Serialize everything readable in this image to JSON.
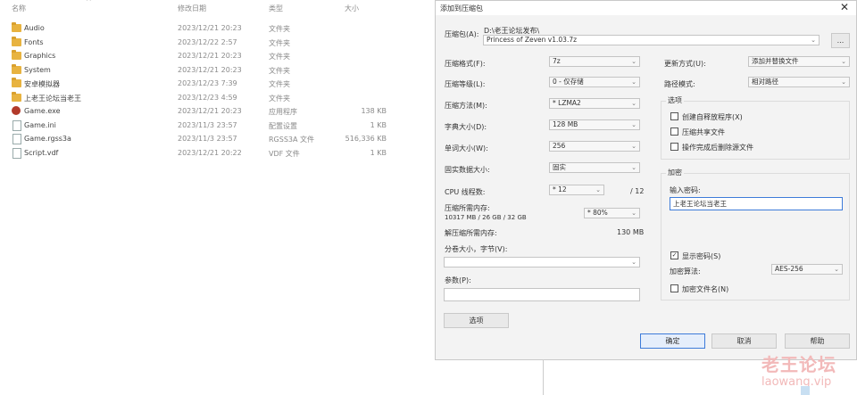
{
  "explorer": {
    "headers": {
      "name": "名称",
      "date": "修改日期",
      "type": "类型",
      "size": "大小"
    },
    "files": [
      {
        "name": "Audio",
        "date": "2023/12/21 20:23",
        "type": "文件夹",
        "size": "",
        "icon": "folder-icon"
      },
      {
        "name": "Fonts",
        "date": "2023/12/22 2:57",
        "type": "文件夹",
        "size": "",
        "icon": "folder-icon"
      },
      {
        "name": "Graphics",
        "date": "2023/12/21 20:23",
        "type": "文件夹",
        "size": "",
        "icon": "folder-icon"
      },
      {
        "name": "System",
        "date": "2023/12/21 20:23",
        "type": "文件夹",
        "size": "",
        "icon": "folder-icon"
      },
      {
        "name": "安卓模拟器",
        "date": "2023/12/23 7:39",
        "type": "文件夹",
        "size": "",
        "icon": "folder-icon"
      },
      {
        "name": "上老王论坛当老王",
        "date": "2023/12/23 4:59",
        "type": "文件夹",
        "size": "",
        "icon": "folder-icon"
      },
      {
        "name": "Game.exe",
        "date": "2023/12/21 20:23",
        "type": "应用程序",
        "size": "138 KB",
        "icon": "exe-icon"
      },
      {
        "name": "Game.ini",
        "date": "2023/11/3 23:57",
        "type": "配置设置",
        "size": "1 KB",
        "icon": "file-icon"
      },
      {
        "name": "Game.rgss3a",
        "date": "2023/11/3 23:57",
        "type": "RGSS3A 文件",
        "size": "516,336 KB",
        "icon": "file-icon"
      },
      {
        "name": "Script.vdf",
        "date": "2023/12/21 20:22",
        "type": "VDF 文件",
        "size": "1 KB",
        "icon": "file-icon"
      }
    ]
  },
  "dialog": {
    "title": "添加到压缩包",
    "close": "✕",
    "archive_label": "压缩包(A):",
    "archive_path": "D:\\老王论坛发布\\",
    "archive_name": "Princess of Zeven v1.03.7z",
    "browse": "...",
    "format_label": "压缩格式(F):",
    "format_value": "7z",
    "level_label": "压缩等级(L):",
    "level_value": "0 - 仅存储",
    "method_label": "压缩方法(M):",
    "method_value": "* LZMA2",
    "dict_label": "字典大小(D):",
    "dict_value": "128 MB",
    "word_label": "单词大小(W):",
    "word_value": "256",
    "solid_label": "固实数据大小:",
    "solid_value": "固实",
    "cpu_label": "CPU 线程数:",
    "cpu_value": "* 12",
    "cpu_total": "/ 12",
    "mem_label": "压缩所需内存:",
    "mem_info": "10317 MB / 26 GB / 32 GB",
    "mem_value": "* 80%",
    "decomp_label": "解压缩所需内存:",
    "decomp_value": "130 MB",
    "split_label": "分卷大小，字节(V):",
    "split_value": "",
    "params_label": "参数(P):",
    "params_value": "",
    "options_button": "选项",
    "update_label": "更新方式(U):",
    "update_value": "添加并替换文件",
    "path_label": "路径模式:",
    "path_value": "相对路径",
    "options_group": "选项",
    "opt_sfx": "创建自释放程序(X)",
    "opt_shared": "压缩共享文件",
    "opt_delete": "操作完成后删除源文件",
    "encrypt_group": "加密",
    "password_label": "输入密码:",
    "password_value": "上老王论坛当老王",
    "show_password": "显示密码(S)",
    "show_password_checked": "✓",
    "enc_method_label": "加密算法:",
    "enc_method_value": "AES-256",
    "encrypt_names": "加密文件名(N)",
    "ok": "确定",
    "cancel": "取消",
    "help": "帮助"
  },
  "watermark": {
    "line1": "老王论坛",
    "line2": "laowang.vip"
  },
  "colors": {
    "accent": "#3d7bd9",
    "folder": "#e8b340",
    "watermark": "#f2b9b9"
  }
}
